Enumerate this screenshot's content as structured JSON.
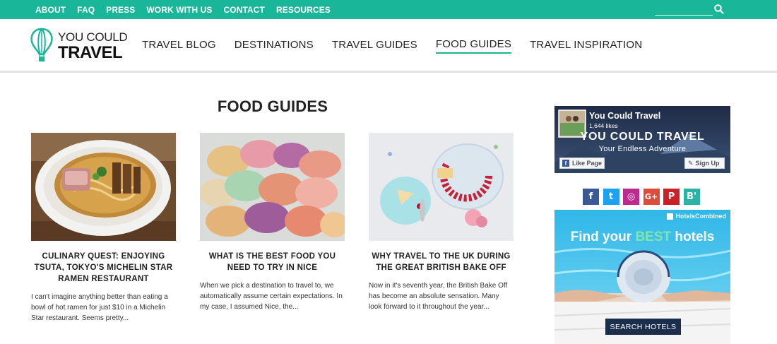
{
  "topnav": {
    "items": [
      "ABOUT",
      "FAQ",
      "PRESS",
      "WORK WITH US",
      "CONTACT",
      "RESOURCES"
    ],
    "search_icon": "search-icon"
  },
  "logo": {
    "line1": "YOU COULD",
    "line2": "TRAVEL",
    "icon": "hot-air-balloon-icon"
  },
  "mainnav": {
    "items": [
      "TRAVEL BLOG",
      "DESTINATIONS",
      "TRAVEL GUIDES",
      "FOOD GUIDES",
      "TRAVEL INSPIRATION"
    ],
    "active": "FOOD GUIDES"
  },
  "page_title": "FOOD GUIDES",
  "posts": [
    {
      "title": "CULINARY QUEST: ENJOYING TSUTA, TOKYO'S MICHELIN STAR RAMEN RESTAURANT",
      "excerpt": "I can't imagine anything better than eating a bowl of hot ramen for just $10 in a Michelin Star restaurant. Seems pretty...",
      "image": "ramen-bowl-photo"
    },
    {
      "title": "WHAT IS THE BEST FOOD YOU NEED TO TRY IN NICE",
      "excerpt": "When we pick a destination to travel to, we automatically assume certain expectations.  In my case, I assumed Nice, the...",
      "image": "macarons-photo"
    },
    {
      "title": "WHY TRAVEL TO THE UK DURING THE GREAT BRITISH BAKE OFF",
      "excerpt": "Now in it's seventh year, the British Bake Off has become an absolute sensation. Many look forward to it throughout the year...",
      "image": "cake-and-berries-photo"
    }
  ],
  "facebook": {
    "page_name": "You Could Travel",
    "likes": "1,644 likes",
    "banner_title": "YOU COULD TRAVEL",
    "banner_subtitle": "Your Endless Adventure",
    "like_label": "Like Page",
    "signup_label": "Sign Up"
  },
  "social": {
    "items": [
      {
        "name": "facebook-icon",
        "glyph": "f",
        "color": "#3b5998"
      },
      {
        "name": "twitter-icon",
        "glyph": "t",
        "color": "#1da1f2"
      },
      {
        "name": "instagram-icon",
        "glyph": "◎",
        "color": "#bc2a8d"
      },
      {
        "name": "google-plus-icon",
        "glyph": "G+",
        "color": "#dd4b39"
      },
      {
        "name": "pinterest-icon",
        "glyph": "P",
        "color": "#cb2027"
      },
      {
        "name": "bloglovin-icon",
        "glyph": "B'",
        "color": "#2bb3a6"
      }
    ]
  },
  "ad": {
    "brand": "HotelsCombined",
    "title_pre": "Find your ",
    "title_best": "BEST",
    "title_post": " hotels",
    "button": "SEARCH HOTELS"
  },
  "colors": {
    "accent": "#19b69a",
    "text": "#222222"
  }
}
